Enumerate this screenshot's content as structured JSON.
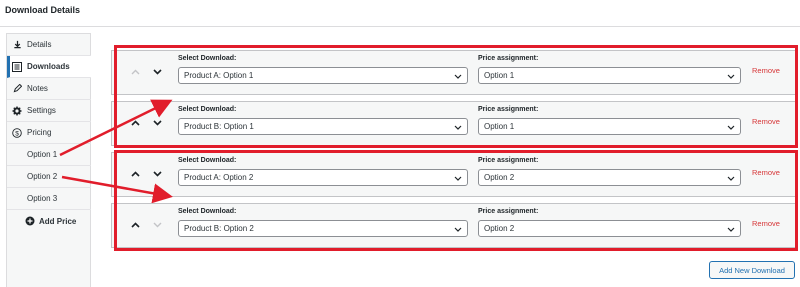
{
  "page": {
    "title": "Download Details"
  },
  "sidebar": {
    "tabs": [
      {
        "label": "Details",
        "icon": "download-icon"
      },
      {
        "label": "Downloads",
        "icon": "list-icon",
        "active": true
      },
      {
        "label": "Notes",
        "icon": "pencil-icon"
      },
      {
        "label": "Settings",
        "icon": "gear-icon"
      },
      {
        "label": "Pricing",
        "icon": "dollar-circle-icon"
      }
    ],
    "pricing_options": [
      "Option 1",
      "Option 2",
      "Option 3"
    ],
    "add_price_label": "Add Price"
  },
  "rows": [
    {
      "download_label": "Select Download:",
      "download_value": "Product A: Option 1",
      "price_label": "Price assignment:",
      "price_value": "Option 1",
      "remove_label": "Remove"
    },
    {
      "download_label": "Select Download:",
      "download_value": "Product B: Option 1",
      "price_label": "Price assignment:",
      "price_value": "Option 1",
      "remove_label": "Remove"
    },
    {
      "download_label": "Select Download:",
      "download_value": "Product A: Option 2",
      "price_label": "Price assignment:",
      "price_value": "Option 2",
      "remove_label": "Remove"
    },
    {
      "download_label": "Select Download:",
      "download_value": "Product B: Option 2",
      "price_label": "Price assignment:",
      "price_value": "Option 2",
      "remove_label": "Remove"
    }
  ],
  "add_new_download_label": "Add New Download",
  "colors": {
    "accent": "#2271b1",
    "remove": "#d63638",
    "highlight": "#e11d2b"
  }
}
